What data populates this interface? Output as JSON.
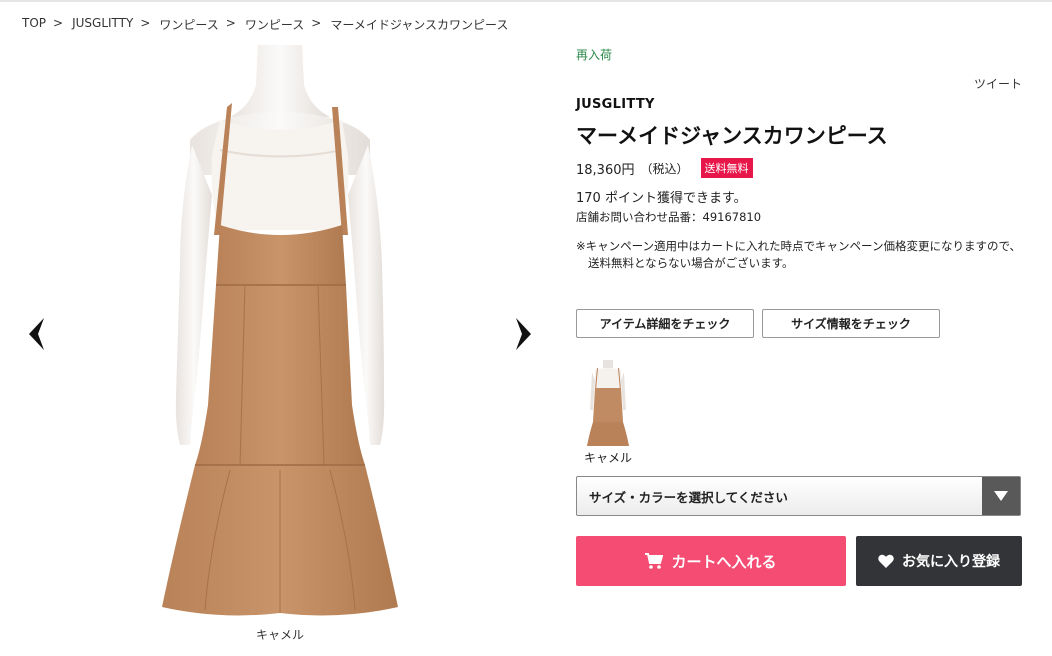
{
  "breadcrumb": [
    {
      "label": "TOP"
    },
    {
      "label": "JUSGLITTY"
    },
    {
      "label": "ワンピース"
    },
    {
      "label": "ワンピース"
    },
    {
      "label": "マーメイドジャンスカワンピース"
    }
  ],
  "breadcrumb_separator": ">",
  "gallery": {
    "caption": "キャメル",
    "prev_icon": "chevron-left-icon",
    "next_icon": "chevron-right-icon"
  },
  "product": {
    "status": "再入荷",
    "share_label": "ツイート",
    "brand": "JUSGLITTY",
    "title": "マーメイドジャンスカワンピース",
    "price": "18,360円",
    "tax_note": "（税込）",
    "shipping_badge": "送料無料",
    "points_text": "170 ポイント獲得できます。",
    "sku_text": "店舗お問い合わせ品番：49167810",
    "notice_line1": "※キャンペーン適用中はカートに入れた時点でキャンペーン価格変更になりますので、",
    "notice_line2": "送料無料とならない場合がございます。"
  },
  "buttons": {
    "item_detail": "アイテム詳細をチェック",
    "size_info": "サイズ情報をチェック",
    "cart": "カートへ入れる",
    "favorite": "お気に入り登録"
  },
  "colors": [
    {
      "name": "キャメル",
      "swatch": "#c08a62"
    }
  ],
  "size_select": {
    "selected": "サイズ・カラーを選択してください"
  },
  "theme": {
    "accent": "#f44c72",
    "badge": "#e8174a",
    "restock": "#2c8a4a",
    "dark_button": "#333437"
  }
}
